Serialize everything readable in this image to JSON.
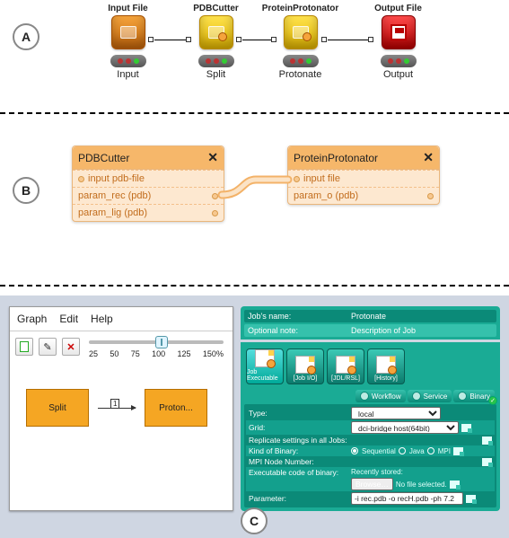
{
  "sections": {
    "A": "A",
    "B": "B",
    "C": "C"
  },
  "panelA": {
    "nodes": [
      {
        "top": "Input File",
        "bottom": "Input",
        "color": "orange",
        "icon": "folder"
      },
      {
        "top": "PDBCutter",
        "bottom": "Split",
        "color": "yellow",
        "icon": "tool"
      },
      {
        "top": "ProteinProtonator",
        "bottom": "Protonate",
        "color": "yellow",
        "icon": "tool"
      },
      {
        "top": "Output File",
        "bottom": "Output",
        "color": "red",
        "icon": "save"
      }
    ]
  },
  "panelB": {
    "left": {
      "title": "PDBCutter",
      "rows": [
        "input pdb-file",
        "param_rec (pdb)",
        "param_lig (pdb)"
      ]
    },
    "right": {
      "title": "ProteinProtonator",
      "rows": [
        "input file",
        "param_o (pdb)"
      ]
    }
  },
  "panelC": {
    "menu": [
      "Graph",
      "Edit",
      "Help"
    ],
    "slider": {
      "ticks": [
        "25",
        "50",
        "75",
        "100",
        "125",
        "150"
      ],
      "unit": "%",
      "value_percent": 54
    },
    "blocks": {
      "left": "Split",
      "right": "Proton..."
    },
    "arrow_label": "1",
    "tags": {
      "left": "0",
      "rightL": "0",
      "rightR": "1"
    },
    "config": {
      "job_name_lbl": "Job's name:",
      "job_name_val": "Protonate",
      "note_lbl": "Optional note:",
      "note_val": "Description of Job",
      "icons": [
        "Job Executable",
        "[Job I/O]",
        "[JDL/RSL]",
        "[History]"
      ],
      "tabs": [
        "Workflow",
        "Service",
        "Binary"
      ],
      "rows": {
        "type_lbl": "Type:",
        "type_val": "local",
        "grid_lbl": "Grid:",
        "grid_val": "dci-bridge host(64bit)",
        "replicate_lbl": "Replicate settings in all Jobs:",
        "kind_lbl": "Kind of Binary:",
        "kind_opts": [
          "Sequential",
          "Java",
          "MPI"
        ],
        "mpi_lbl": "MPI Node Number:",
        "exec_lbl": "Executable code of binary:",
        "recent_lbl": "Recently stored:",
        "browse_btn": "Browse…",
        "nofile": "No file selected.",
        "param_lbl": "Parameter:",
        "param_val": "-i rec.pdb -o recH.pdb -ph 7.2"
      }
    }
  }
}
